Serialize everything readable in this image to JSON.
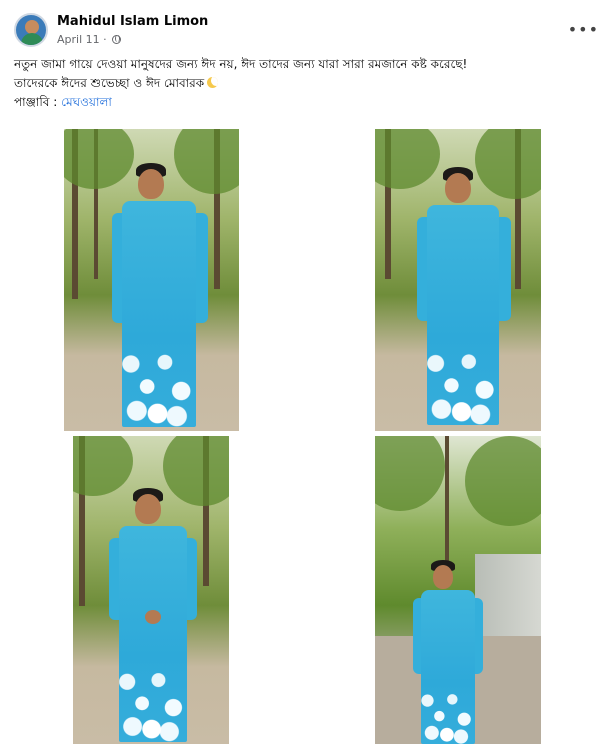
{
  "post": {
    "author": "Mahidul Islam Limon",
    "date": "April 11",
    "date_separator": " · ",
    "more_label": "•••",
    "text_line1": "নতুন জামা গায়ে দেওয়া মানুষদের জন্য ঈদ নয়, ঈদ তাদের জন্য যারা সারা রমজানে কষ্ট করেছে!",
    "text_line2": "তাদেরকে ঈদের শুভেচ্ছা ও ঈদ মোবারক",
    "text_line3_prefix": "পাঞ্জাবি : ",
    "text_line3_link": "মেঘওয়ালা",
    "moon_icon": "crescent-moon-icon",
    "privacy_icon": "globe-icon"
  },
  "photos": [
    {
      "name": "photo-1",
      "kurta_color": "#32aedb",
      "scene": "forest path"
    },
    {
      "name": "photo-2",
      "kurta_color": "#32aedb",
      "scene": "forest path"
    },
    {
      "name": "photo-3",
      "kurta_color": "#32aedb",
      "scene": "forest path"
    },
    {
      "name": "photo-4",
      "kurta_color": "#32aedb",
      "scene": "road by wall"
    }
  ],
  "colors": {
    "link": "#216fdb",
    "muted": "#65676b",
    "kurta": "#32aedb"
  }
}
